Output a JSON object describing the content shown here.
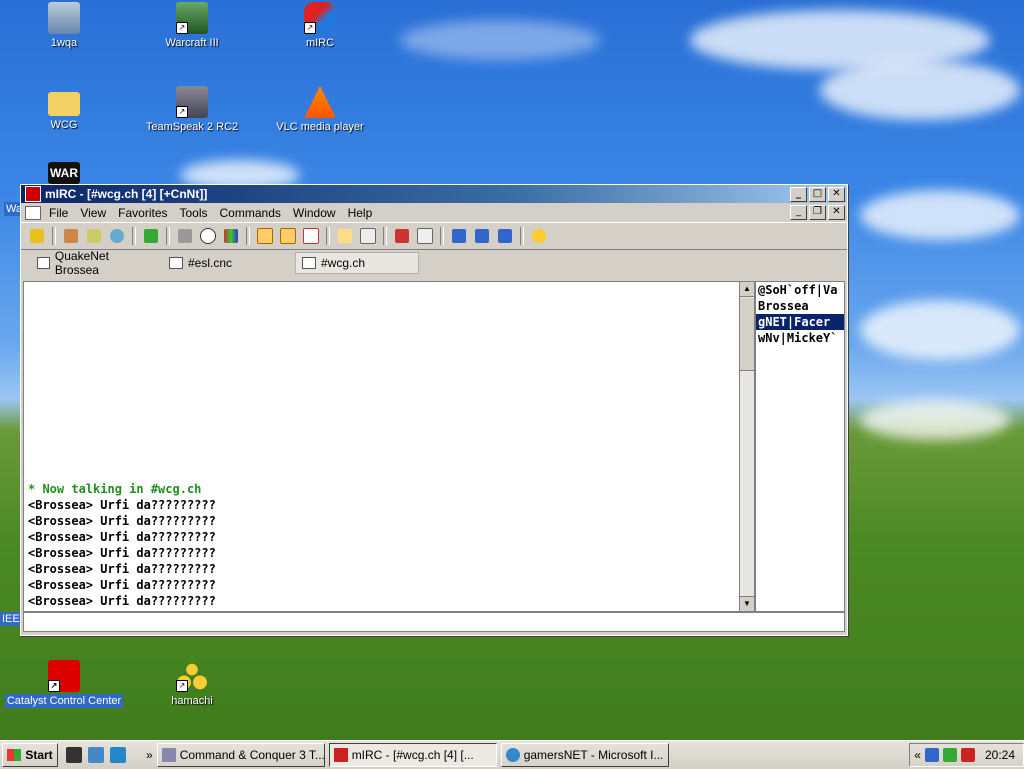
{
  "desktop": {
    "icons": [
      {
        "label": "1wqa",
        "name": "my-computer-icon"
      },
      {
        "label": "Warcraft III",
        "name": "warcraft-iii-icon"
      },
      {
        "label": "mIRC",
        "name": "mirc-icon"
      },
      {
        "label": "WCG",
        "name": "folder-icon"
      },
      {
        "label": "TeamSpeak 2 RC2",
        "name": "teamspeak-icon"
      },
      {
        "label": "VLC media player",
        "name": "vlc-icon"
      },
      {
        "label": "Catalyst Control Center",
        "name": "catalyst-icon"
      },
      {
        "label": "hamachi",
        "name": "hamachi-icon"
      }
    ],
    "partial_labels": {
      "left_wa": "Wa",
      "left_ie": "IEE"
    },
    "war_badge": "WAR"
  },
  "mirc": {
    "title": "mIRC - [#wcg.ch [4] [+CnNt]]",
    "menu": [
      "File",
      "View",
      "Favorites",
      "Tools",
      "Commands",
      "Window",
      "Help"
    ],
    "switchbar": [
      {
        "label": "QuakeNet Brossea"
      },
      {
        "label": "#esl.cnc"
      },
      {
        "label": "#wcg.ch",
        "active": true
      }
    ],
    "chat_lines": [
      {
        "text": "* Now talking in #wcg.ch",
        "type": "sys"
      },
      {
        "text": "<Brossea> Urfi da?????????",
        "type": "msg"
      },
      {
        "text": "<Brossea> Urfi da?????????",
        "type": "msg"
      },
      {
        "text": "<Brossea> Urfi da?????????",
        "type": "msg"
      },
      {
        "text": "<Brossea> Urfi da?????????",
        "type": "msg"
      },
      {
        "text": "<Brossea> Urfi da?????????",
        "type": "msg"
      },
      {
        "text": "<Brossea> Urfi da?????????",
        "type": "msg"
      },
      {
        "text": "<Brossea> Urfi da?????????",
        "type": "msg"
      }
    ],
    "nicks": [
      {
        "text": "@SoH`off|Va",
        "selected": false
      },
      {
        "text": "Brossea",
        "selected": false
      },
      {
        "text": "gNET|Facer",
        "selected": true
      },
      {
        "text": "wNv|MickeY`",
        "selected": false
      }
    ],
    "input_value": ""
  },
  "taskbar": {
    "start_label": "Start",
    "chevron": "»",
    "tasks": [
      {
        "label": "Command & Conquer 3 T...",
        "active": false
      },
      {
        "label": "mIRC - [#wcg.ch [4] [...",
        "active": true
      },
      {
        "label": "gamersNET - Microsoft I...",
        "active": false
      }
    ],
    "tray_chevron": "«",
    "clock": "20:24"
  }
}
